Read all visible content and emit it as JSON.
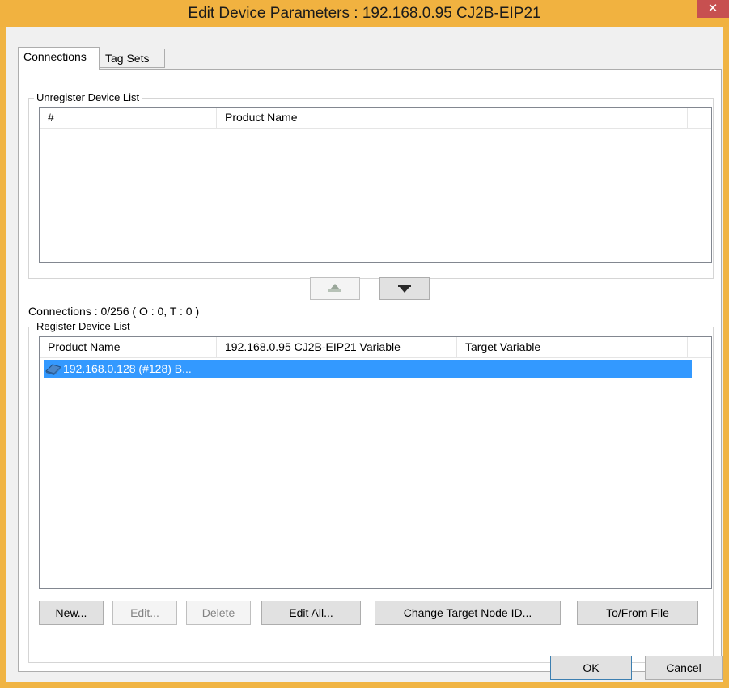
{
  "window": {
    "title": "Edit Device Parameters : 192.168.0.95 CJ2B-EIP21",
    "close_glyph": "✕"
  },
  "tabs": [
    {
      "label": "Connections",
      "active": true
    },
    {
      "label": "Tag Sets",
      "active": false
    }
  ],
  "unregister_list": {
    "label": "Unregister Device List",
    "columns": [
      "#",
      "Product Name"
    ],
    "rows": []
  },
  "connections_status": "Connections :  0/256 ( O : 0, T : 0 )",
  "move_buttons": [
    {
      "name": "move-up-icon",
      "enabled": false
    },
    {
      "name": "move-down-icon",
      "enabled": true
    }
  ],
  "register_list": {
    "label": "Register Device List",
    "columns": [
      "Product Name",
      "192.168.0.95 CJ2B-EIP21 Variable",
      "Target Variable"
    ],
    "rows": [
      {
        "product_name": "192.168.0.128 (#128) B...",
        "icon": "device-icon",
        "variable": "",
        "target_variable": "",
        "selected": true
      }
    ]
  },
  "action_buttons": {
    "new": "New...",
    "edit": "Edit...",
    "delete": "Delete",
    "edit_all": "Edit All...",
    "change_target": "Change Target Node ID...",
    "to_from_file": "To/From File"
  },
  "dialog_buttons": {
    "ok": "OK",
    "cancel": "Cancel"
  },
  "colors": {
    "title_bar": "#f1b240",
    "selection": "#3399ff",
    "close": "#c75050"
  }
}
